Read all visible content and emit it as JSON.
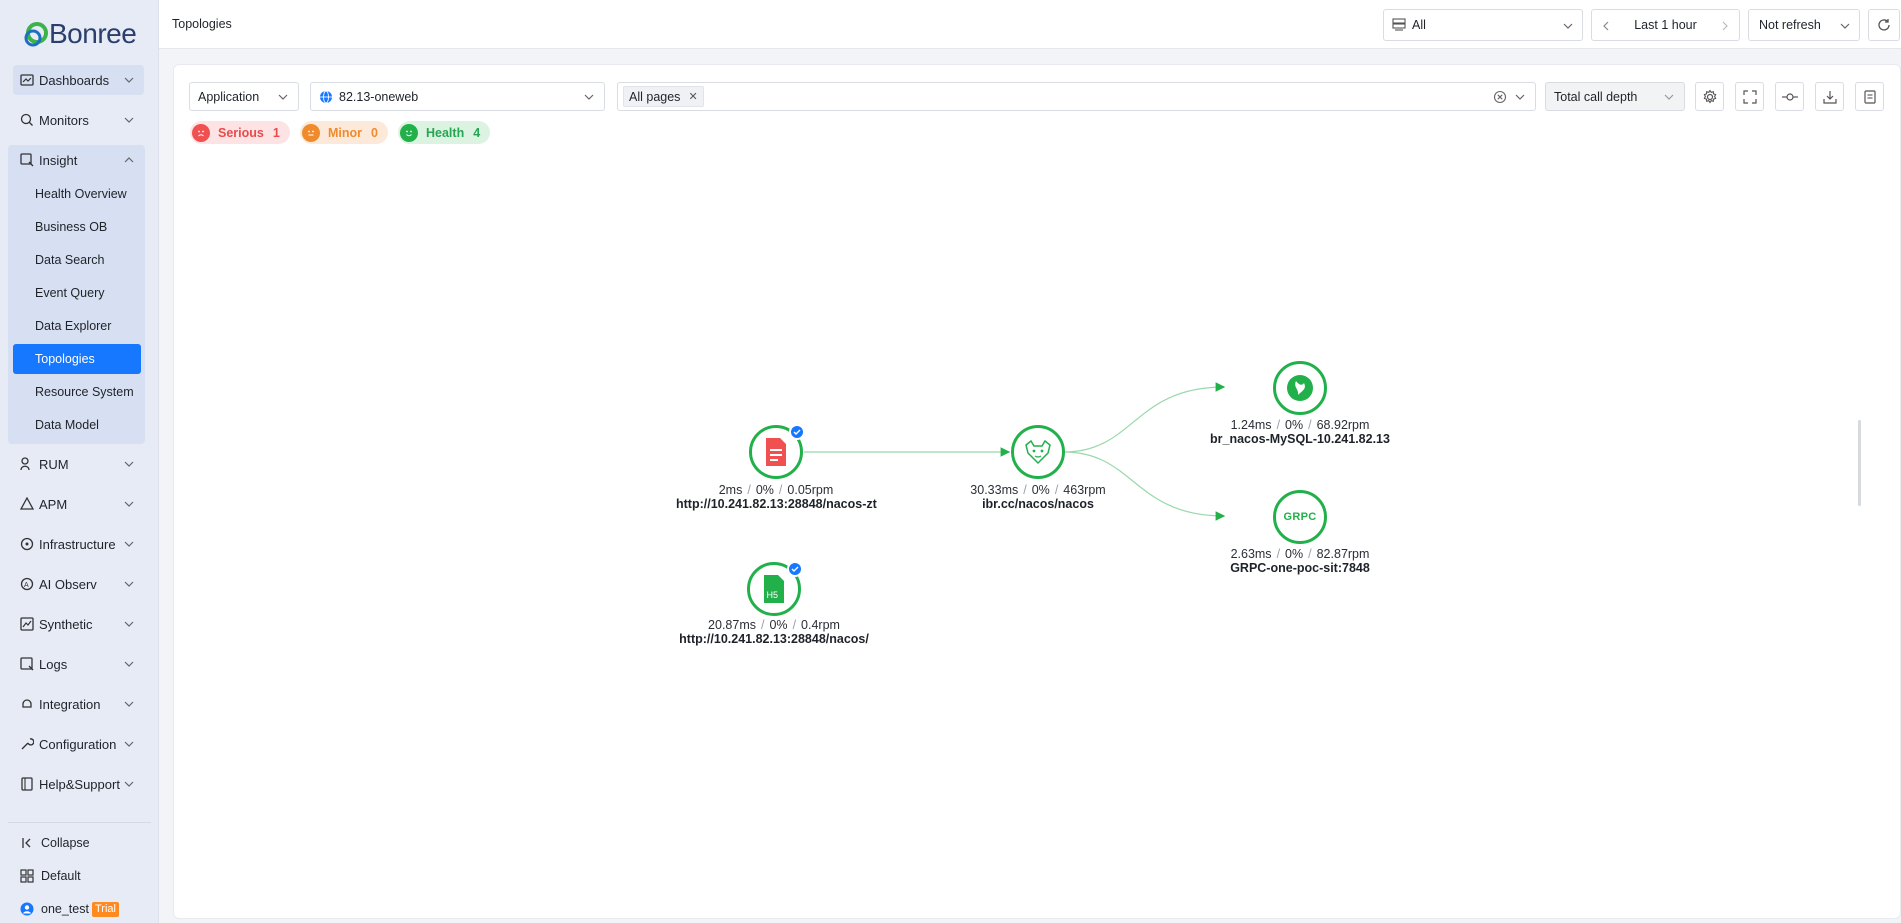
{
  "app": {
    "logo_text": "Bonree"
  },
  "sidebar": {
    "items": [
      {
        "label": "Dashboards"
      },
      {
        "label": "Monitors"
      },
      {
        "label": "Insight"
      },
      {
        "label": "RUM"
      },
      {
        "label": "APM"
      },
      {
        "label": "Infrastructure"
      },
      {
        "label": "AI Observ"
      },
      {
        "label": "Synthetic"
      },
      {
        "label": "Logs"
      },
      {
        "label": "Integration"
      },
      {
        "label": "Configuration"
      },
      {
        "label": "Help&Support"
      }
    ],
    "insight_sub": [
      {
        "label": "Health Overview"
      },
      {
        "label": "Business OB"
      },
      {
        "label": "Data Search"
      },
      {
        "label": "Event Query"
      },
      {
        "label": "Data Explorer"
      },
      {
        "label": "Topologies"
      },
      {
        "label": "Resource System"
      },
      {
        "label": "Data Model"
      }
    ],
    "collapse_label": "Collapse",
    "workspace_label": "Default",
    "user_name": "one_test",
    "user_badge": "Trial"
  },
  "header": {
    "title": "Topologies",
    "env_select": "All",
    "time_range": "Last 1 hour",
    "refresh_select": "Not refresh"
  },
  "filters": {
    "type_select": "Application",
    "app_select": "82.13-oneweb",
    "page_tag": "All pages",
    "depth_select": "Total call depth"
  },
  "status": {
    "serious_label": "Serious",
    "serious_count": "1",
    "minor_label": "Minor",
    "minor_count": "0",
    "health_label": "Health",
    "health_count": "4"
  },
  "topology": {
    "nodes": [
      {
        "id": "page-nacos-zt",
        "metrics": [
          "2ms",
          "0%",
          "0.05rpm"
        ],
        "name": "http://10.241.82.13:28848/nacos-zt",
        "status": "serious"
      },
      {
        "id": "page-nacos",
        "metrics": [
          "20.87ms",
          "0%",
          "0.4rpm"
        ],
        "name": "http://10.241.82.13:28848/nacos/",
        "status": "health"
      },
      {
        "id": "tomcat",
        "metrics": [
          "30.33ms",
          "0%",
          "463rpm"
        ],
        "name": "ibr.cc/nacos/nacos",
        "status": "health"
      },
      {
        "id": "mysql",
        "metrics": [
          "1.24ms",
          "0%",
          "68.92rpm"
        ],
        "name": "br_nacos-MySQL-10.241.82.13",
        "status": "health"
      },
      {
        "id": "grpc",
        "metrics": [
          "2.63ms",
          "0%",
          "82.87rpm"
        ],
        "name": "GRPC-one-poc-sit:7848",
        "status": "health",
        "icon_text": "GRPC"
      }
    ],
    "h5_icon_text": "H5"
  },
  "colors": {
    "accent": "#1677ff",
    "health": "#22b04b",
    "serious": "#f05050",
    "minor": "#f08b2d"
  }
}
